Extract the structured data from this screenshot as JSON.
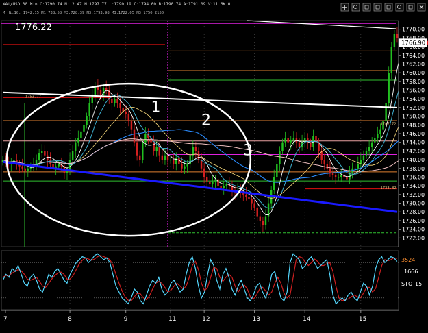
{
  "window": {
    "header_line1": "XAU/USD 30 Min  C:1790.74  N: 2.47  H:1797.77  L:1790.19  O:1794.00  B:1790.74  A:1791.09  V:11.6K  O",
    "header_line2": "M Hi:1G: 1742.15 M1:738.58 M3:728.39 M3:1793.98 M3:1722.05 M3:1750 2150",
    "last_price": "1776.22",
    "tool_icons": [
      "crosshair-icon",
      "magnifier-icon",
      "cursor-icon",
      "pin-icon",
      "bar-icon",
      "zoom-icon",
      "expand-icon",
      "close-icon"
    ]
  },
  "colors": {
    "background": "#000000",
    "candle_up": "#22c020",
    "candle_down": "#d42020",
    "ma_blue": "#1a1aff",
    "stoch_k": "#55d8ff",
    "stoch_d": "#d02020",
    "magenta": "#e020e0",
    "orange": "#e08030",
    "green_level": "#30c030",
    "red_level": "#e01010",
    "current_tag": "#ffffff"
  },
  "chart_data": {
    "type": "candlestick",
    "ylim": [
      1720,
      1772
    ],
    "y_ticks": [
      1722,
      1724,
      1726,
      1728,
      1730,
      1732,
      1734,
      1736,
      1738,
      1740,
      1742,
      1744,
      1746,
      1748,
      1750,
      1752,
      1754,
      1756,
      1758,
      1760,
      1762,
      1764,
      1766,
      1768,
      1770
    ],
    "y_tick_labels": [
      "1722.00",
      "1724.00",
      "1726.00",
      "1728.00",
      "1730.00",
      "1732.00",
      "1734.00",
      "1736.00",
      "1738.00",
      "1740.00",
      "1742.00",
      "1744.00",
      "1746.00",
      "1748.00",
      "1750.00",
      "1752.00",
      "1754.00",
      "1756.00",
      "1758.00",
      "1760.00",
      "1762.00",
      "1764.00",
      "1766.00",
      "1768.00",
      "1770.00"
    ],
    "current_price": 1766.9,
    "current_price_label": "1766.90",
    "x_day_labels": [
      {
        "label": "7",
        "bar": 0
      },
      {
        "label": "8",
        "bar": 24
      },
      {
        "label": "9",
        "bar": 44
      },
      {
        "label": "11",
        "bar": 60
      },
      {
        "label": "12",
        "bar": 72
      },
      {
        "label": "13",
        "bar": 90
      },
      {
        "label": "14",
        "bar": 108
      },
      {
        "label": "15",
        "bar": 128
      }
    ],
    "bars_visible": 142,
    "closes": [
      1740,
      1739.5,
      1739,
      1739.5,
      1740,
      1739,
      1738.5,
      1738,
      1737.5,
      1738,
      1738.5,
      1739,
      1740,
      1741.5,
      1742,
      1741,
      1740,
      1739,
      1738,
      1738.5,
      1739,
      1738.5,
      1737,
      1737.5,
      1740,
      1742,
      1744,
      1745,
      1746.5,
      1748,
      1750,
      1753,
      1755,
      1757,
      1756,
      1755,
      1756.5,
      1756,
      1754,
      1753,
      1754,
      1753,
      1752,
      1751,
      1750.5,
      1749,
      1747,
      1744,
      1741,
      1740,
      1744,
      1746,
      1745,
      1744,
      1742,
      1743,
      1741,
      1740,
      1741,
      1740,
      1740,
      1739,
      1740.5,
      1739,
      1738,
      1738.5,
      1739,
      1741,
      1743,
      1742,
      1740,
      1738,
      1736,
      1735,
      1734.5,
      1735,
      1735.5,
      1734,
      1733.5,
      1734,
      1734.5,
      1734,
      1733,
      1732.5,
      1733,
      1732.5,
      1732,
      1731.5,
      1731,
      1730,
      1729,
      1727,
      1726,
      1725,
      1727,
      1730,
      1733,
      1736,
      1739,
      1742,
      1744,
      1745,
      1744,
      1744.5,
      1745,
      1744,
      1743,
      1744,
      1745,
      1744,
      1743,
      1745.5,
      1744,
      1742,
      1740,
      1739,
      1738,
      1737,
      1736.5,
      1736,
      1736,
      1736.5,
      1736,
      1735.5,
      1737,
      1738,
      1738,
      1739,
      1740,
      1741,
      1742,
      1743,
      1744,
      1745,
      1746,
      1747,
      1749,
      1753,
      1760,
      1766,
      1769,
      1768,
      1767,
      1766.9
    ],
    "horizontal_levels": [
      {
        "name": "red-top-left",
        "value": 1766.5,
        "color": "red",
        "from_bar": 0,
        "to_bar": 59
      },
      {
        "name": "orange-1765",
        "value": 1765,
        "color": "orange",
        "from_bar": 59,
        "to_bar": 142
      },
      {
        "name": "orange-1760",
        "value": 1760.5,
        "color": "orange",
        "from_bar": 59,
        "to_bar": 142
      },
      {
        "name": "green-1758",
        "value": 1758.3,
        "color": "green",
        "from_bar": 59,
        "to_bar": 142
      },
      {
        "name": "red-1754",
        "value": 1754.3,
        "color": "red",
        "from_bar": 0,
        "to_bar": 40
      },
      {
        "name": "orange-1749",
        "value": 1749,
        "color": "orange",
        "from_bar": 0,
        "to_bar": 142
      },
      {
        "name": "pink-1744",
        "value": 1744.3,
        "color": "pink",
        "from_bar": 0,
        "to_bar": 142
      },
      {
        "name": "magenta-1741",
        "value": 1741.2,
        "color": "magenta",
        "from_bar": 59,
        "to_bar": 142
      },
      {
        "name": "orange-1737",
        "value": 1737.2,
        "color": "orange",
        "from_bar": 0,
        "to_bar": 142
      },
      {
        "name": "green-1735",
        "value": 1735.1,
        "color": "green",
        "from_bar": 0,
        "to_bar": 142
      },
      {
        "name": "red-1733",
        "value": 1733.3,
        "color": "red",
        "from_bar": 108,
        "to_bar": 142
      },
      {
        "name": "green-dash-1723",
        "value": 1723.2,
        "color": "green",
        "from_bar": 59,
        "to_bar": 142
      },
      {
        "name": "red-1721",
        "value": 1721.5,
        "color": "red",
        "from_bar": 59,
        "to_bar": 142
      }
    ],
    "blue_trendline": {
      "from": [
        0,
        1739.5
      ],
      "to": [
        142,
        1728
      ]
    },
    "white_trendline": {
      "from": [
        0,
        1755.5
      ],
      "to": [
        142,
        1752
      ]
    },
    "annotations": [
      {
        "label": "1",
        "bar": 53,
        "value": 1751
      },
      {
        "label": "2",
        "bar": 71,
        "value": 1748
      },
      {
        "label": "3",
        "bar": 86,
        "value": 1741
      }
    ],
    "price_tags": [
      {
        "label": "1747.72",
        "bar": 135,
        "value": 1748
      },
      {
        "label": "1733.82",
        "bar": 135,
        "value": 1733.2
      },
      {
        "label": "1753.77",
        "bar": 8,
        "value": 1754.3
      }
    ],
    "stochastic": {
      "ylim": [
        0,
        100
      ],
      "k": [
        50,
        60,
        55,
        70,
        65,
        75,
        60,
        45,
        40,
        55,
        60,
        50,
        35,
        30,
        45,
        60,
        55,
        65,
        70,
        60,
        50,
        45,
        60,
        70,
        80,
        85,
        90,
        88,
        80,
        85,
        92,
        95,
        90,
        85,
        88,
        80,
        60,
        40,
        30,
        20,
        15,
        10,
        20,
        35,
        30,
        15,
        10,
        25,
        40,
        50,
        45,
        55,
        35,
        25,
        30,
        45,
        50,
        40,
        30,
        35,
        60,
        80,
        90,
        70,
        40,
        20,
        30,
        60,
        85,
        75,
        50,
        35,
        60,
        70,
        55,
        35,
        25,
        40,
        50,
        35,
        20,
        15,
        25,
        40,
        45,
        30,
        20,
        35,
        60,
        65,
        40,
        20,
        15,
        30,
        80,
        95,
        90,
        85,
        70,
        75,
        85,
        90,
        80,
        70,
        75,
        80,
        85,
        60,
        25,
        10,
        15,
        20,
        15,
        25,
        30,
        20,
        15,
        30,
        45,
        40,
        25,
        40,
        70,
        85,
        90,
        80,
        85,
        90,
        88,
        82
      ],
      "d": [
        55,
        58,
        58,
        62,
        65,
        68,
        66,
        60,
        52,
        50,
        52,
        55,
        48,
        40,
        38,
        45,
        52,
        58,
        62,
        64,
        60,
        52,
        52,
        58,
        68,
        78,
        84,
        88,
        86,
        84,
        86,
        90,
        92,
        90,
        88,
        85,
        76,
        60,
        45,
        32,
        22,
        16,
        15,
        22,
        28,
        27,
        20,
        17,
        24,
        35,
        45,
        48,
        45,
        38,
        30,
        33,
        40,
        45,
        40,
        35,
        40,
        55,
        75,
        82,
        68,
        45,
        32,
        38,
        55,
        72,
        70,
        55,
        48,
        55,
        60,
        55,
        40,
        30,
        38,
        42,
        35,
        22,
        18,
        25,
        35,
        38,
        32,
        25,
        30,
        45,
        55,
        45,
        28,
        20,
        25,
        55,
        85,
        90,
        88,
        80,
        75,
        80,
        86,
        82,
        75,
        75,
        78,
        80,
        65,
        40,
        20,
        15,
        17,
        18,
        22,
        25,
        22,
        20,
        28,
        38,
        38,
        30,
        36,
        55,
        75,
        85,
        83,
        85,
        88,
        87
      ]
    },
    "stoch_labels": {
      "upper": "3524",
      "mid": "1666",
      "name": "STO",
      "value": "15,"
    }
  }
}
